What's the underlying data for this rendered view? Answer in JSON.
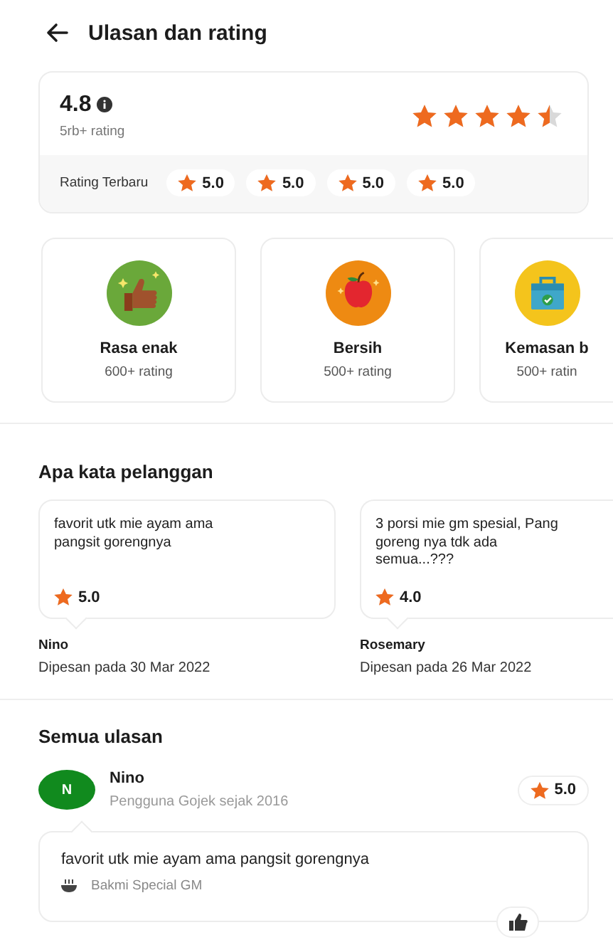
{
  "header": {
    "title": "Ulasan dan rating"
  },
  "summary": {
    "score": "4.8",
    "count": "5rb+ rating",
    "stars": 4.5,
    "recent_label": "Rating Terbaru",
    "recent": [
      "5.0",
      "5.0",
      "5.0",
      "5.0"
    ]
  },
  "categories": [
    {
      "kind": "taste",
      "label": "Rasa enak",
      "count": "600+ rating"
    },
    {
      "kind": "clean",
      "label": "Bersih",
      "count": "500+ rating"
    },
    {
      "kind": "package",
      "label": "Kemasan b",
      "count": "500+ ratin"
    }
  ],
  "testimonials": {
    "title": "Apa kata pelanggan",
    "items": [
      {
        "text": "favorit utk mie ayam ama\npangsit gorengnya",
        "rating": "5.0",
        "name": "Nino",
        "date": "Dipesan pada 30 Mar 2022"
      },
      {
        "text": "3 porsi mie gm spesial, Pang\ngoreng nya tdk ada\nsemua...???",
        "rating": "4.0",
        "name": "Rosemary",
        "date": "Dipesan pada 26 Mar 2022"
      }
    ]
  },
  "reviews": {
    "title": "Semua ulasan",
    "items": [
      {
        "initial": "N",
        "name": "Nino",
        "since": "Pengguna Gojek sejak 2016",
        "rating": "5.0",
        "text": "favorit utk mie ayam ama pangsit gorengnya",
        "dish": "Bakmi Special GM"
      }
    ]
  }
}
